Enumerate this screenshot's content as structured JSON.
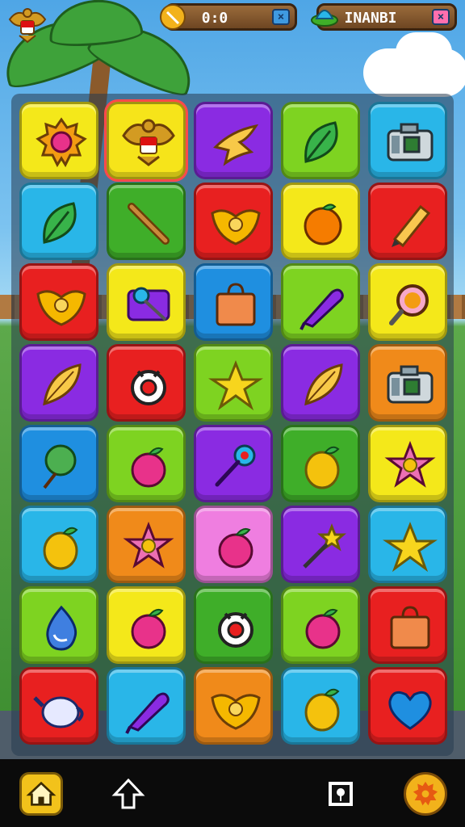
{
  "hud": {
    "score_value": "0:0",
    "player_name": "INANBI",
    "score_close": "×",
    "player_close": "×",
    "colors": {
      "pill": "#6e4622",
      "score_close_bg": "#3f9ae0",
      "player_close_bg": "#ff6fae"
    }
  },
  "grid": {
    "columns": 5,
    "rows": 8,
    "tiles": [
      {
        "color": "#f4e81a",
        "icon": "sun-gem-icon"
      },
      {
        "color": "#f6e41a",
        "icon": "garuda-emblem-icon",
        "selected": true
      },
      {
        "color": "#8a2be2",
        "icon": "bird-icon"
      },
      {
        "color": "#7ed321",
        "icon": "leaf-icon"
      },
      {
        "color": "#29b6e8",
        "icon": "camera-icon"
      },
      {
        "color": "#29b6e8",
        "icon": "leaf-icon"
      },
      {
        "color": "#3fae29",
        "icon": "stick-icon"
      },
      {
        "color": "#e82020",
        "icon": "shield-wings-icon"
      },
      {
        "color": "#f4e81a",
        "icon": "orange-icon"
      },
      {
        "color": "#e82020",
        "icon": "pencil-icon"
      },
      {
        "color": "#e82020",
        "icon": "shield-wings-icon"
      },
      {
        "color": "#f4e81a",
        "icon": "key-icon"
      },
      {
        "color": "#1f8fe0",
        "icon": "bag-icon"
      },
      {
        "color": "#7ed321",
        "icon": "marker-icon"
      },
      {
        "color": "#f4e81a",
        "icon": "magnifier-icon"
      },
      {
        "color": "#8a2be2",
        "icon": "feather-icon"
      },
      {
        "color": "#e82020",
        "icon": "ring-icon"
      },
      {
        "color": "#7ed321",
        "icon": "star-icon"
      },
      {
        "color": "#8a2be2",
        "icon": "feather-icon"
      },
      {
        "color": "#f08a1a",
        "icon": "camera-icon"
      },
      {
        "color": "#1f8fe0",
        "icon": "lollipop-icon"
      },
      {
        "color": "#7ed321",
        "icon": "apple-icon"
      },
      {
        "color": "#8a2be2",
        "icon": "wand-icon"
      },
      {
        "color": "#3fae29",
        "icon": "lemon-icon"
      },
      {
        "color": "#f4e81a",
        "icon": "flower-icon"
      },
      {
        "color": "#29b6e8",
        "icon": "lemon-icon"
      },
      {
        "color": "#f08a1a",
        "icon": "flower-icon"
      },
      {
        "color": "#ef7ee0",
        "icon": "apple-icon"
      },
      {
        "color": "#8a2be2",
        "icon": "wand-star-icon"
      },
      {
        "color": "#29b6e8",
        "icon": "star-icon"
      },
      {
        "color": "#7ed321",
        "icon": "drop-icon"
      },
      {
        "color": "#f4e81a",
        "icon": "apple-icon"
      },
      {
        "color": "#3fae29",
        "icon": "ring-icon"
      },
      {
        "color": "#7ed321",
        "icon": "apple-icon"
      },
      {
        "color": "#e82020",
        "icon": "bag-icon"
      },
      {
        "color": "#e82020",
        "icon": "teapot-icon"
      },
      {
        "color": "#29b6e8",
        "icon": "marker-icon"
      },
      {
        "color": "#f08a1a",
        "icon": "shield-wings-icon"
      },
      {
        "color": "#29b6e8",
        "icon": "lemon-icon"
      },
      {
        "color": "#e82020",
        "icon": "heart-icon"
      }
    ]
  },
  "navbar": {
    "items": [
      {
        "icon": "home-icon"
      },
      {
        "icon": "up-arrow-icon"
      },
      {
        "icon": "card-icon"
      },
      {
        "icon": "gear-badge-icon"
      }
    ]
  }
}
